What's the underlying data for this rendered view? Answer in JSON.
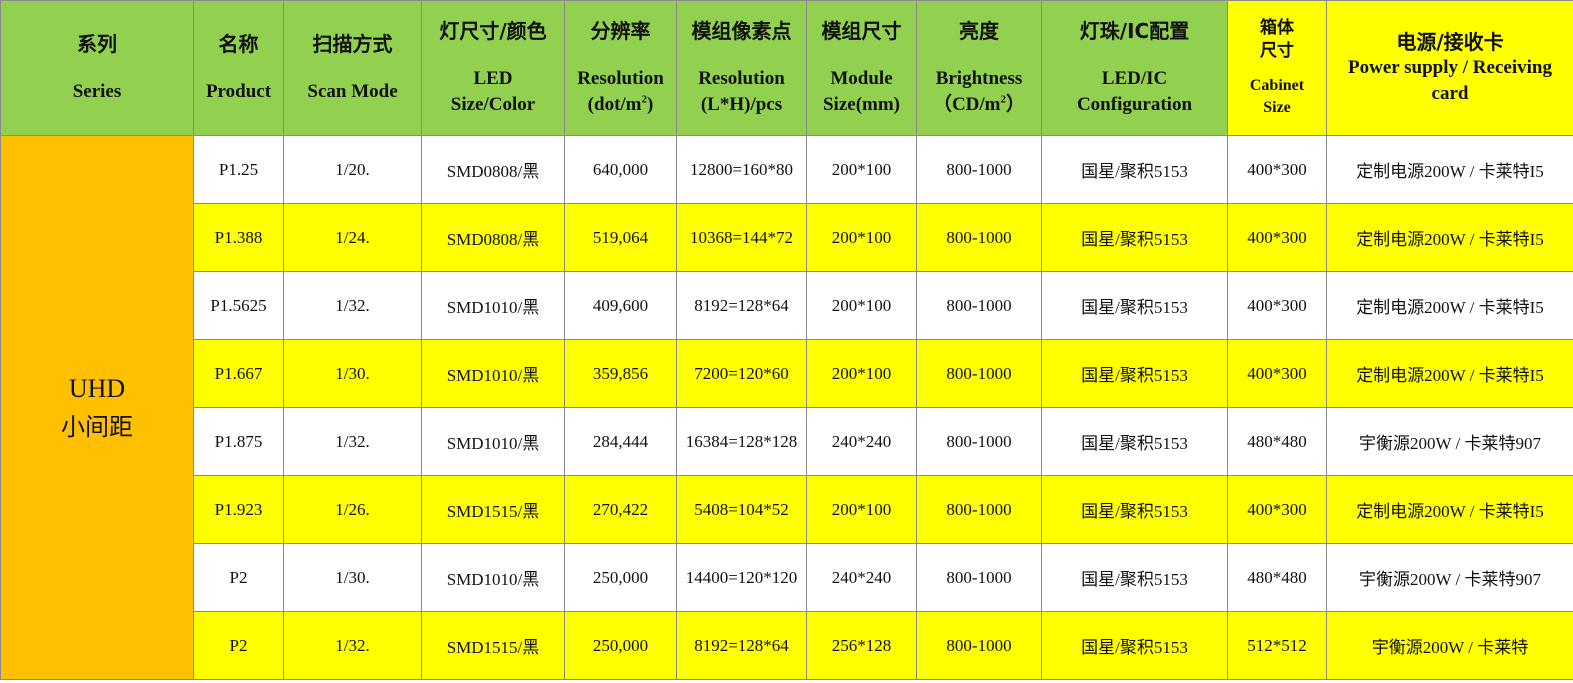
{
  "headers": {
    "series": {
      "cn": "系列",
      "en": "Series"
    },
    "product": {
      "cn": "名称",
      "en": "Product"
    },
    "scan": {
      "cn": "扫描方式",
      "en": "Scan Mode"
    },
    "led": {
      "cn": "灯尺寸/颜色",
      "en1": "LED",
      "en2": "Size/Color"
    },
    "resolution": {
      "cn": "分辨率",
      "en1": "Resolution",
      "en2": "(dot/m",
      "sup": "2",
      "en2_end": ")"
    },
    "pixels": {
      "cn": "模组像素点",
      "en1": "Resolution",
      "en2": "(L*H)/pcs"
    },
    "module": {
      "cn": "模组尺寸",
      "en1": "Module",
      "en2": "Size(mm)"
    },
    "brightness": {
      "cn": "亮度",
      "en1": "Brightness",
      "en2": "（CD/m",
      "sup": "2",
      "en2_end": "）"
    },
    "ic": {
      "cn": "灯珠/IC配置",
      "en1": "LED/IC",
      "en2": "Configuration"
    },
    "cabinet": {
      "cn1": "箱体",
      "cn2": "尺寸",
      "en1": "Cabinet",
      "en2": "Size"
    },
    "power": {
      "cn": "电源/接收卡",
      "en1": "Power supply / Receiving",
      "en2": "card"
    }
  },
  "series": {
    "line1": "UHD",
    "line2": "小间距"
  },
  "rows": [
    {
      "product": "P1.25",
      "scan": "1/20.",
      "led": "SMD0808/黑",
      "resolution": "640,000",
      "pixels": "12800=160*80",
      "module": "200*100",
      "brightness": "800-1000",
      "ic": "国星/聚积5153",
      "cabinet": "400*300",
      "power": "定制电源200W / 卡莱特I5"
    },
    {
      "product": "P1.388",
      "scan": "1/24.",
      "led": "SMD0808/黑",
      "resolution": "519,064",
      "pixels": "10368=144*72",
      "module": "200*100",
      "brightness": "800-1000",
      "ic": "国星/聚积5153",
      "cabinet": "400*300",
      "power": "定制电源200W / 卡莱特I5"
    },
    {
      "product": "P1.5625",
      "scan": "1/32.",
      "led": "SMD1010/黑",
      "resolution": "409,600",
      "pixels": "8192=128*64",
      "module": "200*100",
      "brightness": "800-1000",
      "ic": "国星/聚积5153",
      "cabinet": "400*300",
      "power": "定制电源200W / 卡莱特I5"
    },
    {
      "product": "P1.667",
      "scan": "1/30.",
      "led": "SMD1010/黑",
      "resolution": "359,856",
      "pixels": "7200=120*60",
      "module": "200*100",
      "brightness": "800-1000",
      "ic": "国星/聚积5153",
      "cabinet": "400*300",
      "power": "定制电源200W / 卡莱特I5"
    },
    {
      "product": "P1.875",
      "scan": "1/32.",
      "led": "SMD1010/黑",
      "resolution": "284,444",
      "pixels": "16384=128*128",
      "module": "240*240",
      "brightness": "800-1000",
      "ic": "国星/聚积5153",
      "cabinet": "480*480",
      "power": "宇衡源200W / 卡莱特907"
    },
    {
      "product": "P1.923",
      "scan": "1/26.",
      "led": "SMD1515/黑",
      "resolution": "270,422",
      "pixels": "5408=104*52",
      "module": "200*100",
      "brightness": "800-1000",
      "ic": "国星/聚积5153",
      "cabinet": "400*300",
      "power": "定制电源200W / 卡莱特I5"
    },
    {
      "product": "P2",
      "scan": "1/30.",
      "led": "SMD1010/黑",
      "resolution": "250,000",
      "pixels": "14400=120*120",
      "module": "240*240",
      "brightness": "800-1000",
      "ic": "国星/聚积5153",
      "cabinet": "480*480",
      "power": "宇衡源200W / 卡莱特907"
    },
    {
      "product": "P2",
      "scan": "1/32.",
      "led": "SMD1515/黑",
      "resolution": "250,000",
      "pixels": "8192=128*64",
      "module": "256*128",
      "brightness": "800-1000",
      "ic": "国星/聚积5153",
      "cabinet": "512*512",
      "power": "宇衡源200W / 卡莱特"
    }
  ],
  "colors": {
    "header_green": "#92d050",
    "highlight_yellow": "#ffff00",
    "series_orange": "#ffc000"
  }
}
